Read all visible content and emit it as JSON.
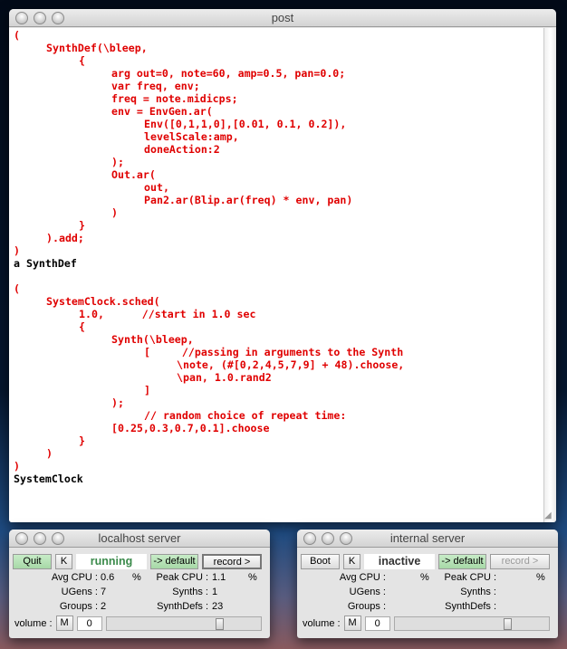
{
  "post": {
    "title": "post",
    "lines": [
      {
        "t": "(",
        "i": 0
      },
      {
        "t": "SynthDef(\\bleep,",
        "i": 1
      },
      {
        "t": "{",
        "i": 2
      },
      {
        "t": "arg out=0, note=60, amp=0.5, pan=0.0;",
        "i": 3
      },
      {
        "t": "var freq, env;",
        "i": 3
      },
      {
        "t": "freq = note.midicps;",
        "i": 3
      },
      {
        "t": "env = EnvGen.ar(",
        "i": 3
      },
      {
        "t": "Env([0,1,1,0],[0.01, 0.1, 0.2]),",
        "i": 4
      },
      {
        "t": "levelScale:amp,",
        "i": 4
      },
      {
        "t": "doneAction:2",
        "i": 4
      },
      {
        "t": ");",
        "i": 3
      },
      {
        "t": "Out.ar(",
        "i": 3
      },
      {
        "t": "out,",
        "i": 4
      },
      {
        "t": "Pan2.ar(Blip.ar(freq) * env, pan)",
        "i": 4
      },
      {
        "t": ")",
        "i": 3
      },
      {
        "t": "}",
        "i": 2
      },
      {
        "t": ").add;",
        "i": 1
      },
      {
        "t": ")",
        "i": 0
      },
      {
        "t": "a SynthDef",
        "i": 0,
        "out": true
      },
      {
        "t": "",
        "i": 0
      },
      {
        "t": "(",
        "i": 0
      },
      {
        "t": "SystemClock.sched(",
        "i": 1
      },
      {
        "t": "1.0,      //start in 1.0 sec",
        "i": 2
      },
      {
        "t": "{",
        "i": 2
      },
      {
        "t": "Synth(\\bleep,",
        "i": 3
      },
      {
        "t": "[     //passing in arguments to the Synth",
        "i": 4
      },
      {
        "t": "\\note, (#[0,2,4,5,7,9] + 48).choose,",
        "i": 5
      },
      {
        "t": "\\pan, 1.0.rand2",
        "i": 5
      },
      {
        "t": "]",
        "i": 4
      },
      {
        "t": ");",
        "i": 3
      },
      {
        "t": "// random choice of repeat time:",
        "i": 4
      },
      {
        "t": "[0.25,0.3,0.7,0.1].choose",
        "i": 3
      },
      {
        "t": "}",
        "i": 2
      },
      {
        "t": ")",
        "i": 1
      },
      {
        "t": ")",
        "i": 0
      },
      {
        "t": "SystemClock",
        "i": 0,
        "out": true
      }
    ]
  },
  "servers": [
    {
      "title": "localhost server",
      "boot": "Quit",
      "boot_green": true,
      "kill": "K",
      "status": "running",
      "status_color": "#3a8a4a",
      "default": "-> default",
      "record": "record >",
      "record_enabled": true,
      "avg_label": "Avg CPU :",
      "avg": "0.6",
      "pct": "%",
      "peak_label": "Peak CPU :",
      "peak": "1.1",
      "ugens_label": "UGens :",
      "ugens": "7",
      "synths_label": "Synths :",
      "synths": "1",
      "groups_label": "Groups :",
      "groups": "2",
      "defs_label": "SynthDefs :",
      "defs": "23",
      "volume_label": "volume :",
      "mute": "M",
      "volume": "0",
      "volume_slider": 0.75
    },
    {
      "title": "internal server",
      "boot": "Boot",
      "boot_green": false,
      "kill": "K",
      "status": "inactive",
      "status_color": "#333333",
      "default": "-> default",
      "record": "record >",
      "record_enabled": false,
      "avg_label": "Avg CPU :",
      "avg": "",
      "pct": "%",
      "peak_label": "Peak CPU :",
      "peak": "",
      "ugens_label": "UGens :",
      "ugens": "",
      "synths_label": "Synths :",
      "synths": "",
      "groups_label": "Groups :",
      "groups": "",
      "defs_label": "SynthDefs :",
      "defs": "",
      "volume_label": "volume :",
      "mute": "M",
      "volume": "0",
      "volume_slider": 0.75
    }
  ]
}
